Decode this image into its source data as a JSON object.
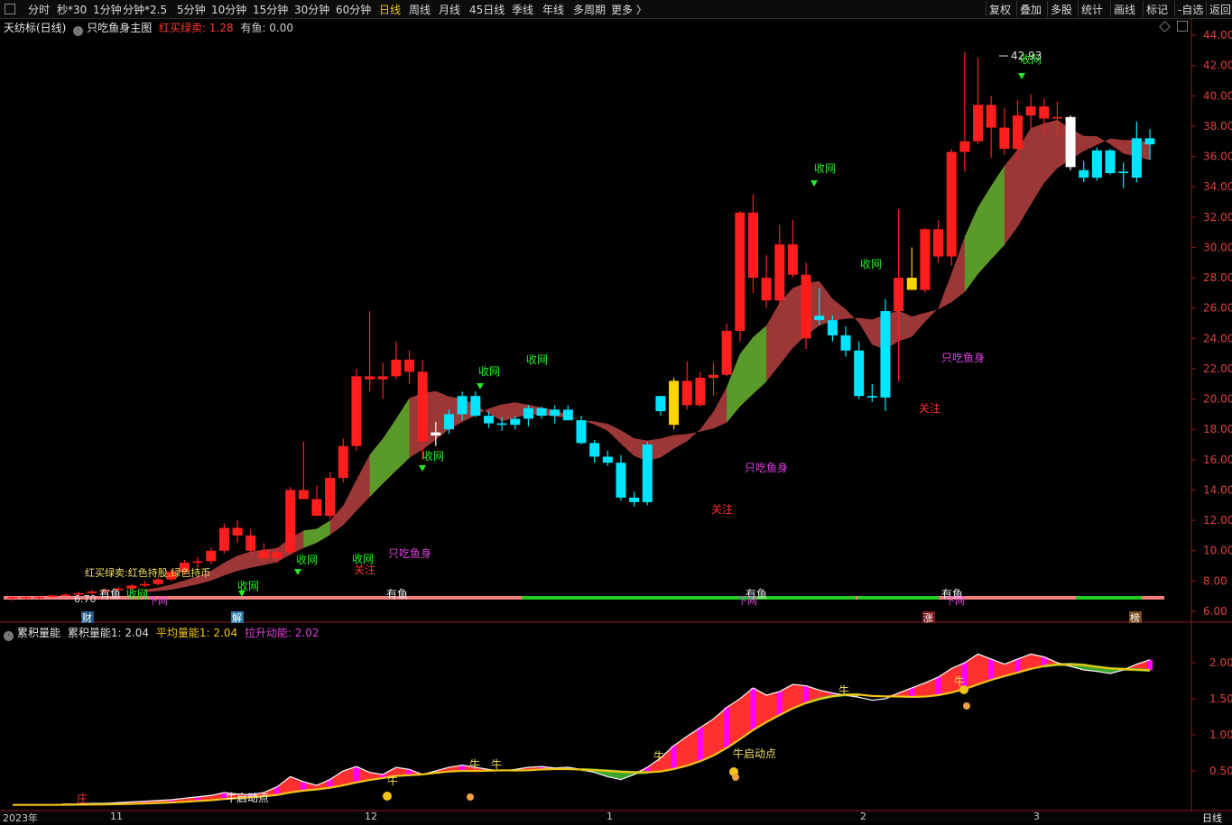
{
  "toolbar": {
    "periods": [
      "分时",
      "秒*30",
      "1分钟",
      "分钟*2.5",
      "5分钟",
      "10分钟",
      "15分钟",
      "30分钟",
      "60分钟",
      "日线",
      "周线",
      "月线",
      "45日线",
      "季线",
      "年线",
      "多周期",
      "更多 〉"
    ],
    "active_period": "日线",
    "right": [
      "复权",
      "叠加",
      "多股",
      "统计",
      "画线",
      "标记",
      "-自选",
      "返回"
    ]
  },
  "main_panel": {
    "stock_name": "天纺标(日线)",
    "indicator_name": "只吃鱼身主图",
    "params": [
      {
        "label": "红买绿卖: 1.28",
        "color": "#ff3b30"
      },
      {
        "label": "有鱼: 0.00",
        "color": "#d0d0d0"
      }
    ],
    "y_ticks": [
      "44.00",
      "42.00",
      "40.00",
      "38.00",
      "36.00",
      "34.00",
      "32.00",
      "30.00",
      "28.00",
      "26.00",
      "24.00",
      "22.00",
      "20.00",
      "18.00",
      "16.00",
      "14.00",
      "12.00",
      "10.00",
      "8.00",
      "6.00"
    ],
    "legend_note": "红买绿卖:红色持股,绿色持币",
    "high_label": "42.93",
    "low_label": "6.70",
    "signals": [
      "收网",
      "收网",
      "收网",
      "收网",
      "收网",
      "收网",
      "收网",
      "收网",
      "收网",
      "收网"
    ],
    "fish_body": [
      "只吃鱼身",
      "只吃鱼身",
      "只吃鱼身"
    ],
    "attention": [
      "关注",
      "关注",
      "关注",
      "关注"
    ],
    "fish_band": [
      "有鱼",
      "有鱼",
      "有鱼",
      "有鱼",
      "有鱼"
    ],
    "net_down": [
      "下网",
      "下网",
      "下网"
    ],
    "badges": [
      "财",
      "解",
      "涨",
      "榜"
    ]
  },
  "sub_panel": {
    "name": "累积量能",
    "params": [
      {
        "label": "累积量能1: 2.04",
        "color": "#e0e0e0"
      },
      {
        "label": "平均量能1: 2.04",
        "color": "#f0c419"
      },
      {
        "label": "拉升动能: 2.02",
        "color": "#e040e0"
      }
    ],
    "y_ticks": [
      "2.00",
      "1.50",
      "1.00",
      "0.50"
    ],
    "labels": {
      "bull": "牛",
      "bull_start": "牛启动点",
      "bull_start2": "牛启动点",
      "zhuang": "庄"
    }
  },
  "date_axis": [
    "2023年",
    "11",
    "12",
    "1",
    "2",
    "3"
  ],
  "period_label": "日线",
  "colors": {
    "up": "#ff1e1e",
    "down": "#00e5ff",
    "ma_band": "#a33a3a",
    "green_band": "#5a9a2a",
    "fish_line_up": "#f08080",
    "fish_line_dn": "#22cc22"
  },
  "chart_data": {
    "type": "candlestick",
    "ylim": [
      6,
      44
    ],
    "candles": [
      [
        6.9,
        7.0,
        6.7,
        6.95
      ],
      [
        6.95,
        7.0,
        6.8,
        6.9
      ],
      [
        6.9,
        7.0,
        6.8,
        6.95
      ],
      [
        6.95,
        7.1,
        6.9,
        7.05
      ],
      [
        7.05,
        7.2,
        7.0,
        7.1
      ],
      [
        7.1,
        7.3,
        7.0,
        7.2
      ],
      [
        7.2,
        7.4,
        7.1,
        7.3
      ],
      [
        7.3,
        7.5,
        7.2,
        7.4
      ],
      [
        7.4,
        7.6,
        7.3,
        7.5
      ],
      [
        7.5,
        7.8,
        7.4,
        7.7
      ],
      [
        7.7,
        8.0,
        7.6,
        7.8
      ],
      [
        7.8,
        8.2,
        7.7,
        8.1
      ],
      [
        8.1,
        8.8,
        8.0,
        8.6
      ],
      [
        8.6,
        9.4,
        8.4,
        9.2
      ],
      [
        9.2,
        9.6,
        8.9,
        9.3
      ],
      [
        9.3,
        10.2,
        9.1,
        10.0
      ],
      [
        10.0,
        11.8,
        9.8,
        11.5
      ],
      [
        11.5,
        12.0,
        10.5,
        11.0
      ],
      [
        11.0,
        11.4,
        9.8,
        10.0
      ],
      [
        10.0,
        10.5,
        9.3,
        9.5
      ],
      [
        9.5,
        10.2,
        9.2,
        9.9
      ],
      [
        9.9,
        14.2,
        9.7,
        14.0
      ],
      [
        14.0,
        17.2,
        13.8,
        13.4
      ],
      [
        13.4,
        14.3,
        12.8,
        12.3
      ],
      [
        12.3,
        15.2,
        12.1,
        14.8
      ],
      [
        14.8,
        17.4,
        14.5,
        16.9
      ],
      [
        16.9,
        22.0,
        16.6,
        21.5
      ],
      [
        21.5,
        25.8,
        20.5,
        21.3
      ],
      [
        21.3,
        22.4,
        20.0,
        21.5
      ],
      [
        21.5,
        23.8,
        21.3,
        22.6
      ],
      [
        22.6,
        23.2,
        21.0,
        21.8
      ],
      [
        21.8,
        22.6,
        16.0,
        17.2
      ],
      [
        17.6,
        18.5,
        16.9,
        17.8
      ],
      [
        18.0,
        19.3,
        17.7,
        19.0
      ],
      [
        19.0,
        20.5,
        18.6,
        20.2
      ],
      [
        20.2,
        20.5,
        18.8,
        18.9
      ],
      [
        18.9,
        19.2,
        18.1,
        18.4
      ],
      [
        18.4,
        18.8,
        17.9,
        18.3
      ],
      [
        18.3,
        18.9,
        18.0,
        18.7
      ],
      [
        18.7,
        19.6,
        18.2,
        19.4
      ],
      [
        19.4,
        19.5,
        18.7,
        18.9
      ],
      [
        18.9,
        19.6,
        18.4,
        19.3
      ],
      [
        19.3,
        19.6,
        18.7,
        18.6
      ],
      [
        18.6,
        18.9,
        17.0,
        17.1
      ],
      [
        17.1,
        17.3,
        15.8,
        16.2
      ],
      [
        16.2,
        16.6,
        15.6,
        15.8
      ],
      [
        15.8,
        16.3,
        13.3,
        13.5
      ],
      [
        13.5,
        13.9,
        12.9,
        13.2
      ],
      [
        13.2,
        17.2,
        13.0,
        17.0
      ],
      [
        19.2,
        20.2,
        18.9,
        20.2
      ],
      [
        18.3,
        21.4,
        18.0,
        21.2
      ],
      [
        21.2,
        22.5,
        19.3,
        19.6
      ],
      [
        19.6,
        21.8,
        19.5,
        21.4
      ],
      [
        21.4,
        22.4,
        20.2,
        21.6
      ],
      [
        21.6,
        25.0,
        21.5,
        24.5
      ],
      [
        24.5,
        32.4,
        23.8,
        32.3
      ],
      [
        32.3,
        33.5,
        27.0,
        28.0
      ],
      [
        28.0,
        29.5,
        26.0,
        26.5
      ],
      [
        26.5,
        31.5,
        26.2,
        30.2
      ],
      [
        30.2,
        31.8,
        28.0,
        28.2
      ],
      [
        28.2,
        29.0,
        23.3,
        24.0
      ],
      [
        25.5,
        27.3,
        24.9,
        25.2
      ],
      [
        25.2,
        25.5,
        23.8,
        24.2
      ],
      [
        24.2,
        24.8,
        22.8,
        23.2
      ],
      [
        23.2,
        23.8,
        20.0,
        20.2
      ],
      [
        20.2,
        21.0,
        19.8,
        20.1
      ],
      [
        20.1,
        26.6,
        19.2,
        25.8
      ],
      [
        25.8,
        32.5,
        21.2,
        28.0
      ],
      [
        28.0,
        30.0,
        27.5,
        27.2
      ],
      [
        27.2,
        31.3,
        27.0,
        31.2
      ],
      [
        31.2,
        31.8,
        29.0,
        29.4
      ],
      [
        29.4,
        36.5,
        28.8,
        36.3
      ],
      [
        36.3,
        42.9,
        35.0,
        37.0
      ],
      [
        37.0,
        42.5,
        36.8,
        39.4
      ],
      [
        39.4,
        40.0,
        35.9,
        37.9
      ],
      [
        37.9,
        39.2,
        36.1,
        36.5
      ],
      [
        36.5,
        39.7,
        35.8,
        38.7
      ],
      [
        38.7,
        40.1,
        37.8,
        39.3
      ],
      [
        39.3,
        39.8,
        37.5,
        38.5
      ],
      [
        38.5,
        39.6,
        37.3,
        38.6
      ],
      [
        38.6,
        38.7,
        35.1,
        35.3
      ],
      [
        35.1,
        35.7,
        34.3,
        34.6
      ],
      [
        34.6,
        36.6,
        34.4,
        36.4
      ],
      [
        36.4,
        36.5,
        34.8,
        34.9
      ],
      [
        34.9,
        35.6,
        33.9,
        35.0
      ],
      [
        34.6,
        38.3,
        34.3,
        37.2
      ],
      [
        37.2,
        37.8,
        35.8,
        36.8
      ]
    ]
  }
}
